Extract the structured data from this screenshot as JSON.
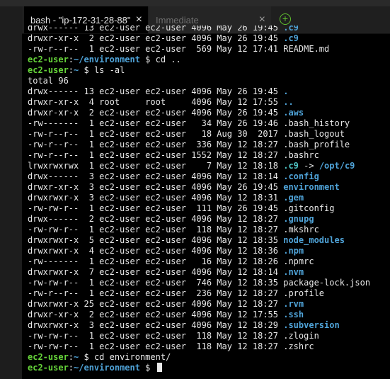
{
  "tabs": [
    {
      "label": "bash - \"ip-172-31-28-88\"",
      "close": "×",
      "active": true
    },
    {
      "label": "Immediate",
      "close": "×",
      "active": false
    }
  ],
  "add_tab_label": "+",
  "terminal": {
    "lines": [
      {
        "segments": [
          {
            "t": "drwx------ 13 ec2-user ec2-user 4096 May 26 19:45 ",
            "c": ""
          },
          {
            "t": ".c9",
            "c": "dir"
          }
        ]
      },
      {
        "segments": [
          {
            "t": "drwxr-xr-x  2 ec2-user ec2-user 4096 May 26 19:45 ",
            "c": ""
          },
          {
            "t": ".c9",
            "c": "dir"
          }
        ]
      },
      {
        "segments": [
          {
            "t": "-rw-r--r--  1 ec2-user ec2-user  569 May 12 17:41 README.md",
            "c": ""
          }
        ]
      },
      {
        "segments": [
          {
            "t": "ec2-user",
            "c": "prompt"
          },
          {
            "t": ":",
            "c": ""
          },
          {
            "t": "~/environment",
            "c": "path"
          },
          {
            "t": " $ cd ..",
            "c": ""
          }
        ]
      },
      {
        "segments": [
          {
            "t": "ec2-user",
            "c": "prompt"
          },
          {
            "t": ":",
            "c": ""
          },
          {
            "t": "~",
            "c": "path"
          },
          {
            "t": " $ ls -al",
            "c": ""
          }
        ]
      },
      {
        "segments": [
          {
            "t": "total 96",
            "c": ""
          }
        ]
      },
      {
        "segments": [
          {
            "t": "drwx------ 13 ec2-user ec2-user 4096 May 26 19:45 ",
            "c": ""
          },
          {
            "t": ".",
            "c": "dir"
          }
        ]
      },
      {
        "segments": [
          {
            "t": "drwxr-xr-x  4 root     root     4096 May 12 17:55 ",
            "c": ""
          },
          {
            "t": "..",
            "c": "dir"
          }
        ]
      },
      {
        "segments": [
          {
            "t": "drwxr-xr-x  2 ec2-user ec2-user 4096 May 26 19:45 ",
            "c": ""
          },
          {
            "t": ".aws",
            "c": "dir"
          }
        ]
      },
      {
        "segments": [
          {
            "t": "-rw-------  1 ec2-user ec2-user   34 May 26 19:46 .bash_history",
            "c": ""
          }
        ]
      },
      {
        "segments": [
          {
            "t": "-rw-r--r--  1 ec2-user ec2-user   18 Aug 30  2017 .bash_logout",
            "c": ""
          }
        ]
      },
      {
        "segments": [
          {
            "t": "-rw-r--r--  1 ec2-user ec2-user  336 May 12 18:27 .bash_profile",
            "c": ""
          }
        ]
      },
      {
        "segments": [
          {
            "t": "-rw-r--r--  1 ec2-user ec2-user 1552 May 12 18:27 .bashrc",
            "c": ""
          }
        ]
      },
      {
        "segments": [
          {
            "t": "lrwxrwxrwx  1 ec2-user ec2-user    7 May 12 18:18 ",
            "c": ""
          },
          {
            "t": ".c9",
            "c": "link"
          },
          {
            "t": " -> ",
            "c": ""
          },
          {
            "t": "/opt/c9",
            "c": "dir"
          }
        ]
      },
      {
        "segments": [
          {
            "t": "drwx------  3 ec2-user ec2-user 4096 May 12 18:14 ",
            "c": ""
          },
          {
            "t": ".config",
            "c": "dir"
          }
        ]
      },
      {
        "segments": [
          {
            "t": "drwxr-xr-x  3 ec2-user ec2-user 4096 May 26 19:45 ",
            "c": ""
          },
          {
            "t": "environment",
            "c": "dir"
          }
        ]
      },
      {
        "segments": [
          {
            "t": "drwxrwxr-x  3 ec2-user ec2-user 4096 May 12 18:31 ",
            "c": ""
          },
          {
            "t": ".gem",
            "c": "dir"
          }
        ]
      },
      {
        "segments": [
          {
            "t": "-rw-rw-r--  1 ec2-user ec2-user  111 May 26 19:45 .gitconfig",
            "c": ""
          }
        ]
      },
      {
        "segments": [
          {
            "t": "drwx------  2 ec2-user ec2-user 4096 May 12 18:27 ",
            "c": ""
          },
          {
            "t": ".gnupg",
            "c": "dir"
          }
        ]
      },
      {
        "segments": [
          {
            "t": "-rw-rw-r--  1 ec2-user ec2-user  118 May 12 18:27 .mkshrc",
            "c": ""
          }
        ]
      },
      {
        "segments": [
          {
            "t": "drwxrwxr-x  5 ec2-user ec2-user 4096 May 12 18:35 ",
            "c": ""
          },
          {
            "t": "node_modules",
            "c": "dir"
          }
        ]
      },
      {
        "segments": [
          {
            "t": "drwxrwxr-x  4 ec2-user ec2-user 4096 May 12 18:36 ",
            "c": ""
          },
          {
            "t": ".npm",
            "c": "dir"
          }
        ]
      },
      {
        "segments": [
          {
            "t": "-rw-------  1 ec2-user ec2-user   16 May 12 18:26 .npmrc",
            "c": ""
          }
        ]
      },
      {
        "segments": [
          {
            "t": "drwxrwxr-x  7 ec2-user ec2-user 4096 May 12 18:14 ",
            "c": ""
          },
          {
            "t": ".nvm",
            "c": "dir"
          }
        ]
      },
      {
        "segments": [
          {
            "t": "-rw-rw-r--  1 ec2-user ec2-user  746 May 12 18:35 package-lock.json",
            "c": ""
          }
        ]
      },
      {
        "segments": [
          {
            "t": "-rw-r--r--  1 ec2-user ec2-user  236 May 12 18:27 .profile",
            "c": ""
          }
        ]
      },
      {
        "segments": [
          {
            "t": "drwxrwxr-x 25 ec2-user ec2-user 4096 May 12 18:27 ",
            "c": ""
          },
          {
            "t": ".rvm",
            "c": "dir"
          }
        ]
      },
      {
        "segments": [
          {
            "t": "drwxr-xr-x  2 ec2-user ec2-user 4096 May 12 17:55 ",
            "c": ""
          },
          {
            "t": ".ssh",
            "c": "dir"
          }
        ]
      },
      {
        "segments": [
          {
            "t": "drwxrwxr-x  3 ec2-user ec2-user 4096 May 12 18:29 ",
            "c": ""
          },
          {
            "t": ".subversion",
            "c": "dir"
          }
        ]
      },
      {
        "segments": [
          {
            "t": "-rw-rw-r--  1 ec2-user ec2-user  118 May 12 18:27 .zlogin",
            "c": ""
          }
        ]
      },
      {
        "segments": [
          {
            "t": "-rw-rw-r--  1 ec2-user ec2-user  118 May 12 18:27 .zshrc",
            "c": ""
          }
        ]
      },
      {
        "segments": [
          {
            "t": "ec2-user",
            "c": "prompt"
          },
          {
            "t": ":",
            "c": ""
          },
          {
            "t": "~",
            "c": "path"
          },
          {
            "t": " $ cd environment/",
            "c": ""
          }
        ]
      },
      {
        "segments": [
          {
            "t": "ec2-user",
            "c": "prompt"
          },
          {
            "t": ":",
            "c": ""
          },
          {
            "t": "~/environment",
            "c": "path"
          },
          {
            "t": " $ ",
            "c": ""
          }
        ],
        "cursor": true
      }
    ]
  },
  "colors": {
    "prompt_user": "#66d43a",
    "prompt_path": "#4fa3d8",
    "directory": "#4fa3d8",
    "symlink": "#4fc4c4",
    "text": "#e8e8e8",
    "terminal_bg": "#000000",
    "add_tab": "#5fbf2f"
  },
  "icons": {
    "tab_close": "close-icon",
    "add_tab": "plus-circle-icon"
  }
}
